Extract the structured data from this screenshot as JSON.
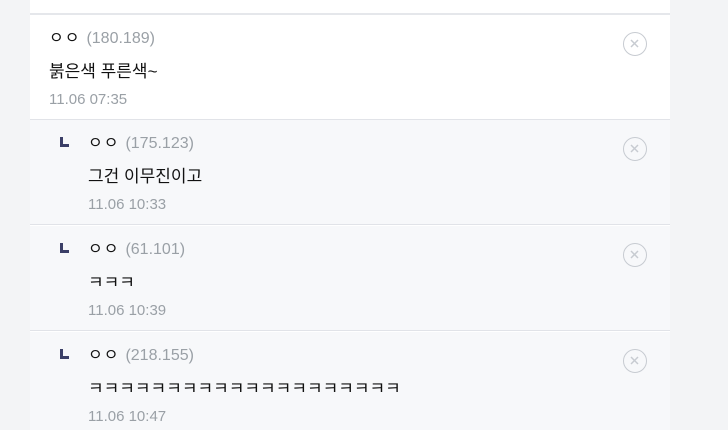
{
  "comments": [
    {
      "nickname": "ㅇㅇ",
      "ip": "(180.189)",
      "text": "붉은색 푸른색~",
      "time": "11.06 07:35",
      "is_reply": false
    },
    {
      "nickname": "ㅇㅇ",
      "ip": "(175.123)",
      "text": "그건 이무진이고",
      "time": "11.06 10:33",
      "is_reply": true
    },
    {
      "nickname": "ㅇㅇ",
      "ip": "(61.101)",
      "text": "ㅋㅋㅋ",
      "time": "11.06 10:39",
      "is_reply": true
    },
    {
      "nickname": "ㅇㅇ",
      "ip": "(218.155)",
      "text": "ㅋㅋㅋㅋㅋㅋㅋㅋㅋㅋㅋㅋㅋㅋㅋㅋㅋㅋㅋㅋ",
      "time": "11.06 10:47",
      "is_reply": true
    }
  ],
  "icons": {
    "delete": "close-circle-icon",
    "reply": "reply-arrow-icon"
  }
}
